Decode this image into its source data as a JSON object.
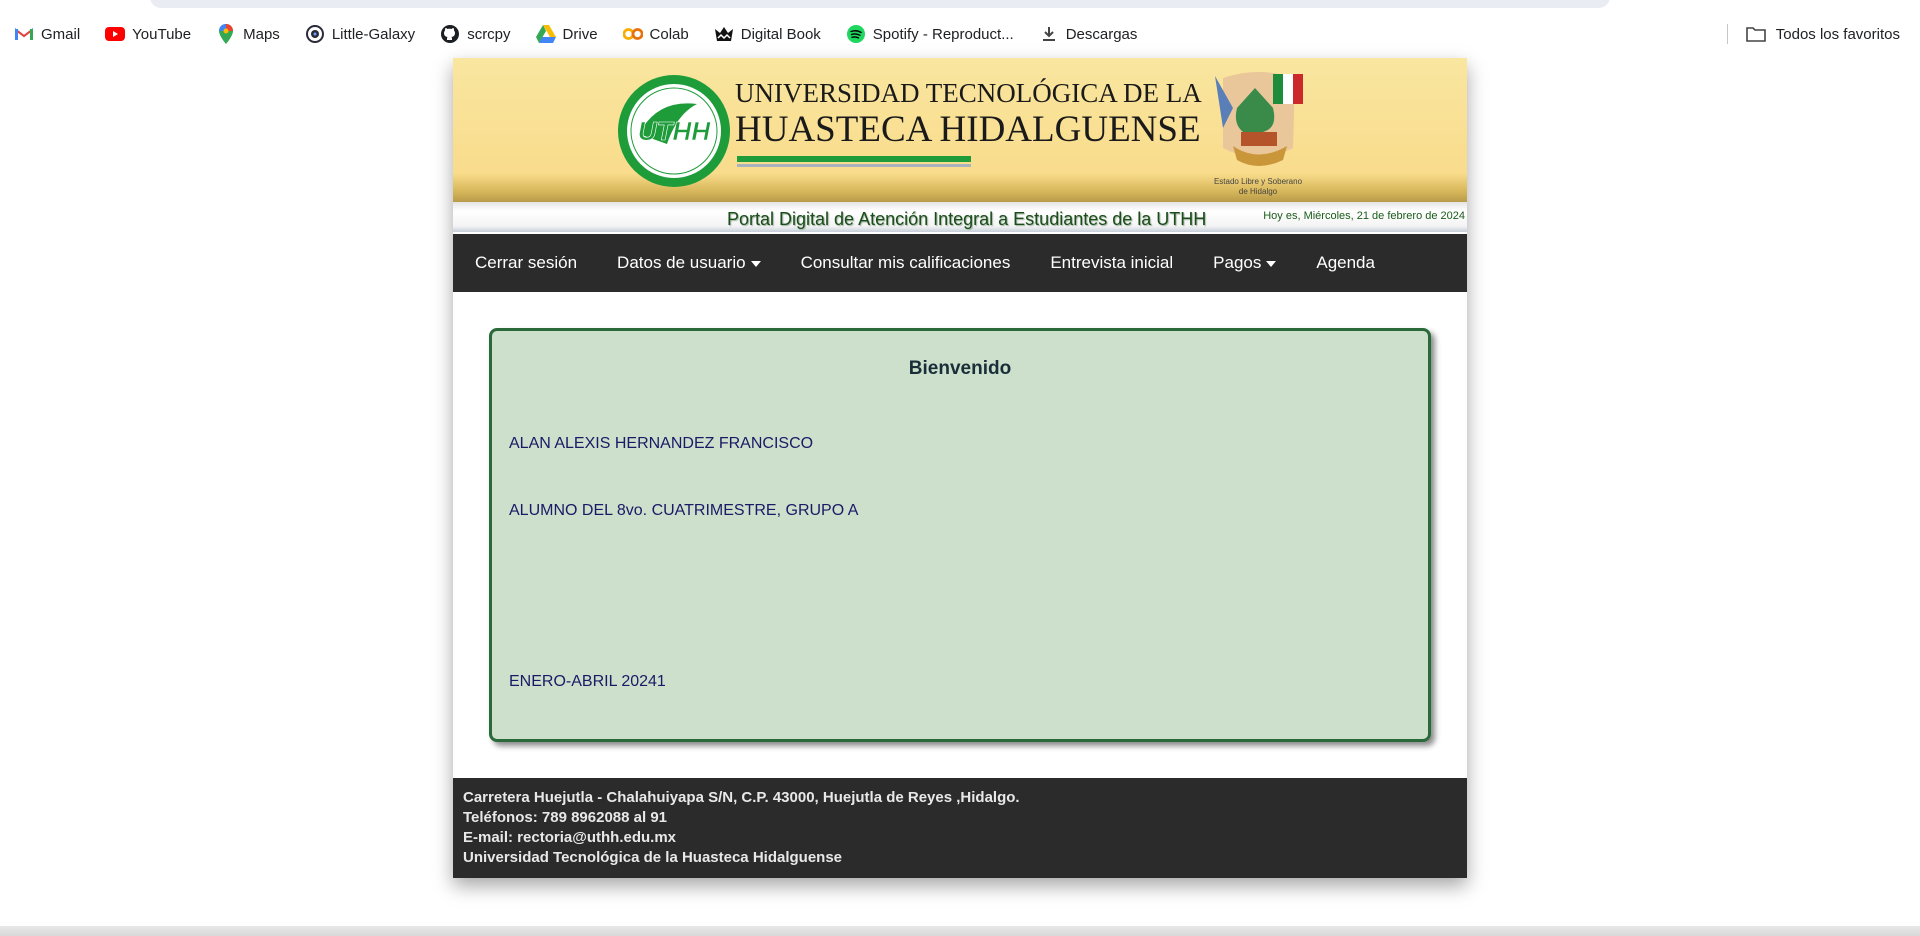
{
  "bookmarks": [
    {
      "label": "Gmail",
      "icon": "gmail-icon"
    },
    {
      "label": "YouTube",
      "icon": "youtube-icon"
    },
    {
      "label": "Maps",
      "icon": "maps-pin-icon"
    },
    {
      "label": "Little-Galaxy",
      "icon": "galaxy-icon"
    },
    {
      "label": "scrcpy",
      "icon": "github-icon"
    },
    {
      "label": "Drive",
      "icon": "drive-icon"
    },
    {
      "label": "Colab",
      "icon": "colab-icon"
    },
    {
      "label": "Digital Book",
      "icon": "digital-book-icon"
    },
    {
      "label": "Spotify - Reproduct...",
      "icon": "spotify-icon"
    },
    {
      "label": "Descargas",
      "icon": "download-icon"
    }
  ],
  "all_bookmarks_label": "Todos los favoritos",
  "banner": {
    "line1": "UNIVERSIDAD TECNOLÓGICA DE LA",
    "line2": "HUASTECA HIDALGUENSE",
    "seal_text": "UTHH",
    "shield_caption1": "Estado Libre y Soberano",
    "shield_caption2": "de Hidalgo"
  },
  "portal": {
    "title": "Portal Digital de Atención Integral a Estudiantes de la UTHH",
    "date": "Hoy es, Miércoles, 21 de febrero de 2024"
  },
  "nav": {
    "logout": "Cerrar sesión",
    "user_data": "Datos de usuario",
    "grades": "Consultar mis calificaciones",
    "interview": "Entrevista inicial",
    "payments": "Pagos",
    "agenda": "Agenda"
  },
  "welcome": {
    "heading": "Bienvenido",
    "student_name": "ALAN ALEXIS HERNANDEZ FRANCISCO",
    "student_info": "ALUMNO DEL 8vo. CUATRIMESTRE, GRUPO A",
    "period": "ENERO-ABRIL 20241"
  },
  "footer": {
    "address": "Carretera Huejutla - Chalahuiyapa S/N, C.P. 43000, Huejutla de Reyes ,Hidalgo.",
    "phones": "Teléfonos: 789 8962088 al 91",
    "email": "E-mail: rectoria@uthh.edu.mx",
    "name": "Universidad Tecnológica de la Huasteca Hidalguense"
  },
  "colors": {
    "banner": "#f9dc8c",
    "nav": "#2b2b2b",
    "welcome_bg": "#cce0cc",
    "welcome_border": "#2a6a3a",
    "brand_green": "#1e9c3a"
  }
}
